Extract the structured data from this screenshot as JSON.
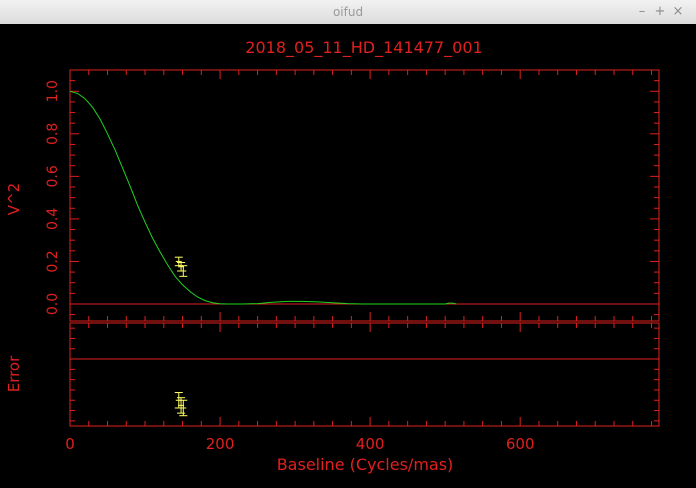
{
  "window": {
    "title": "oifud",
    "controls": {
      "minimize_icon": "minimize-icon",
      "maximize_icon": "maximize-icon",
      "close_icon": "close-icon"
    }
  },
  "colors": {
    "axes": "#e0201e",
    "model": "#21d321",
    "data": "#ffff66",
    "background": "#000000"
  },
  "chart_data": [
    {
      "type": "line",
      "title": "2018_05_11_HD_141477_001",
      "xlabel": "",
      "ylabel": "V^2",
      "xlim": [
        0,
        785
      ],
      "ylim": [
        -0.08,
        1.1
      ],
      "yticks": [
        0.0,
        0.2,
        0.4,
        0.6,
        0.8,
        1.0
      ],
      "ytick_labels": [
        "0.0",
        "0.2",
        "0.4",
        "0.6",
        "0.8",
        "1.0"
      ],
      "zero_line": 0.0,
      "series": [
        {
          "kind": "model",
          "x": [
            0,
            10,
            20,
            30,
            40,
            50,
            60,
            70,
            80,
            90,
            100,
            110,
            120,
            130,
            140,
            150,
            160,
            170,
            180,
            190,
            200,
            210,
            220,
            230,
            250,
            270,
            290,
            310,
            330,
            350,
            370,
            390,
            500,
            505,
            510,
            515
          ],
          "y": [
            1.0,
            0.99,
            0.965,
            0.925,
            0.87,
            0.8,
            0.725,
            0.64,
            0.555,
            0.465,
            0.385,
            0.31,
            0.245,
            0.185,
            0.13,
            0.09,
            0.058,
            0.033,
            0.016,
            0.006,
            0.0015,
            0.0,
            0.0,
            0.0,
            0.002,
            0.008,
            0.012,
            0.012,
            0.01,
            0.006,
            0.002,
            0.0,
            0.0,
            0.004,
            0.004,
            0.0
          ]
        },
        {
          "kind": "data",
          "x": [
            145,
            148,
            151
          ],
          "y": [
            0.2,
            0.175,
            0.155
          ],
          "err": [
            0.02,
            0.02,
            0.025
          ]
        }
      ]
    },
    {
      "type": "scatter",
      "title": "",
      "xlabel": "Baseline (Cycles/mas)",
      "ylabel": "Error",
      "xlim": [
        0,
        785
      ],
      "xticks": [
        0,
        200,
        400,
        600
      ],
      "xtick_labels": [
        "0",
        "200",
        "400",
        "600"
      ],
      "series": [
        {
          "kind": "residual",
          "x": [
            145,
            148,
            151
          ],
          "y": [
            -1.6,
            -1.8,
            -1.9
          ],
          "err": [
            0.3,
            0.3,
            0.3
          ]
        }
      ],
      "ylim": [
        -2.6,
        1.4
      ],
      "reference_line": 0
    }
  ]
}
